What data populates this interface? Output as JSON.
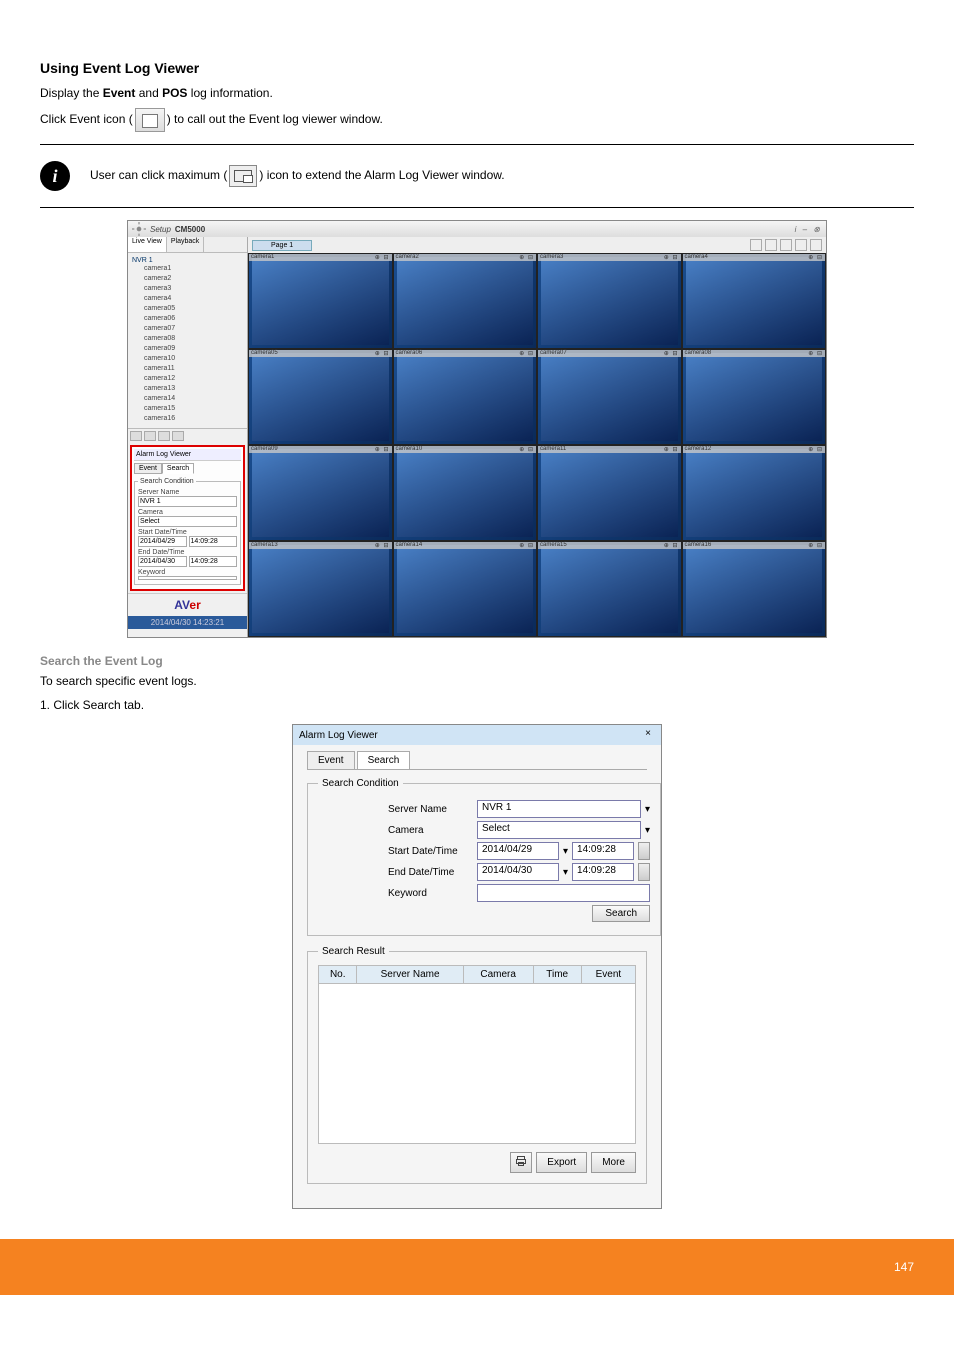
{
  "section": {
    "heading": "Using Event Log Viewer",
    "para1_a": "Display the ",
    "para1_b": "Event",
    "para1_c": " and ",
    "para1_d": "POS",
    "para1_e": " log information.",
    "para2_a": "Click Event icon (",
    "para2_b": ") to call out the Event log viewer window.",
    "note_a": "User can click maximum (",
    "note_b": ") icon to extend the Alarm Log Viewer window."
  },
  "app": {
    "setup": "Setup",
    "product": "CM5000",
    "live_tab": "Live View",
    "playback_tab": "Playback",
    "page_tab": "Page 1",
    "tree_root": "NVR 1",
    "cameras": [
      "camera1",
      "camera2",
      "camera3",
      "camera4",
      "camera05",
      "camera06",
      "camera07",
      "camera08",
      "camera09",
      "camera10",
      "camera11",
      "camera12",
      "camera13",
      "camera14",
      "camera15",
      "camera16"
    ],
    "alarm_panel": {
      "title": "Alarm Log Viewer",
      "tab_event": "Event",
      "tab_search": "Search",
      "legend": "Search Condition",
      "server_label": "Server Name",
      "server_value": "NVR 1",
      "camera_label": "Camera",
      "camera_value": "Select",
      "start_label": "Start Date/Time",
      "start_date": "2014/04/29",
      "start_time": "14:09:28",
      "end_label": "End Date/Time",
      "end_date": "2014/04/30",
      "end_time": "14:09:28",
      "keyword_label": "Keyword"
    },
    "clock": "2014/04/30 14:23:21",
    "tile_labels": [
      "camera1",
      "camera2",
      "camera3",
      "camera4",
      "camera05",
      "camera06",
      "camera07",
      "camera08",
      "camera09",
      "camera10",
      "camera11",
      "camera12",
      "camera13",
      "camera14",
      "camera15",
      "camera16"
    ]
  },
  "searchstep": {
    "title": "Search the Event Log",
    "line1": "To search specific event logs.",
    "line2": "1. Click Search tab."
  },
  "dialog": {
    "title": "Alarm Log Viewer",
    "tab_event": "Event",
    "tab_search": "Search",
    "cond_legend": "Search Condition",
    "server_label": "Server Name",
    "server_value": "NVR 1",
    "camera_label": "Camera",
    "camera_value": "Select",
    "start_label": "Start Date/Time",
    "start_date": "2014/04/29",
    "start_time": "14:09:28",
    "end_label": "End Date/Time",
    "end_date": "2014/04/30",
    "end_time": "14:09:28",
    "keyword_label": "Keyword",
    "search_btn": "Search",
    "result_legend": "Search Result",
    "cols": {
      "no": "No.",
      "server": "Server Name",
      "camera": "Camera",
      "time": "Time",
      "event": "Event"
    },
    "export_btn": "Export",
    "more_btn": "More"
  },
  "footer": {
    "page": "147"
  }
}
